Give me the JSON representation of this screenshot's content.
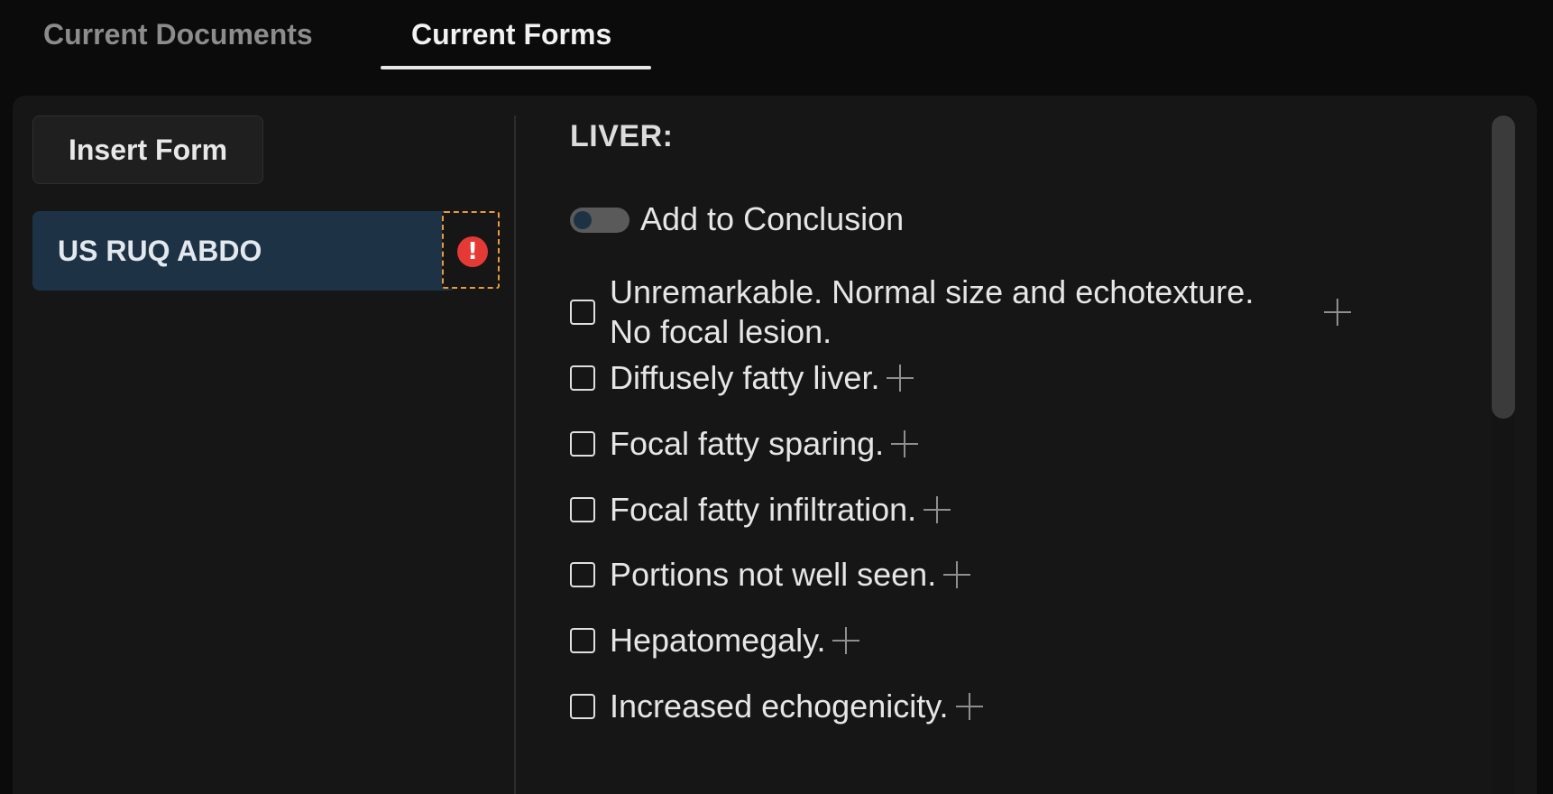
{
  "tabs": [
    {
      "label": "Current Documents",
      "active": false
    },
    {
      "label": "Current Forms",
      "active": true
    }
  ],
  "left_panel": {
    "insert_button_label": "Insert Form",
    "forms": [
      {
        "label": "US RUQ ABDO",
        "selected": true,
        "alert_icon": "exclamation-circle-icon",
        "alert_color": "#e53935"
      }
    ]
  },
  "right_panel": {
    "section_title": "LIVER:",
    "toggle": {
      "label": "Add to Conclusion",
      "on": false
    },
    "options": [
      {
        "label": "Unremarkable. Normal size and echotexture. No focal lesion.",
        "checked": false
      },
      {
        "label": "Diffusely fatty liver.",
        "checked": false
      },
      {
        "label": "Focal fatty sparing.",
        "checked": false
      },
      {
        "label": "Focal fatty infiltration.",
        "checked": false
      },
      {
        "label": "Portions not well seen.",
        "checked": false
      },
      {
        "label": "Hepatomegaly.",
        "checked": false
      },
      {
        "label": "Increased echogenicity.",
        "checked": false
      }
    ]
  },
  "colors": {
    "background": "#0b0b0b",
    "panel": "#161616",
    "selected_form": "#1d3345",
    "alert_outline": "#e89a3c"
  }
}
